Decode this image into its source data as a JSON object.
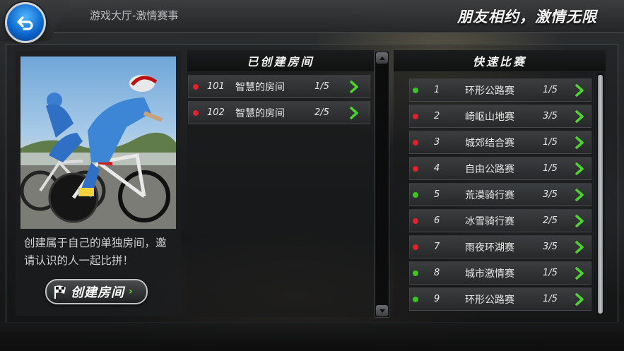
{
  "header": {
    "breadcrumb": "游戏大厅-激情赛事",
    "slogan": "朋友相约，激情无限",
    "back_icon": "back-arrow-icon"
  },
  "left_panel": {
    "description": "创建属于自己的单独房间，邀请认识的人一起比拼！",
    "create_button_label": "创建房间",
    "create_button_icon": "checkered-flag-icon"
  },
  "created_rooms": {
    "title": "已创建房间",
    "rooms": [
      {
        "id": "101",
        "name": "智慧的房间",
        "players": "1/5",
        "status": "red"
      },
      {
        "id": "102",
        "name": "智慧的房间",
        "players": "2/5",
        "status": "red"
      }
    ]
  },
  "quick_match": {
    "title": "快速比赛",
    "matches": [
      {
        "num": "1",
        "name": "环形公路赛",
        "players": "1/5",
        "status": "green"
      },
      {
        "num": "2",
        "name": "崎岖山地赛",
        "players": "3/5",
        "status": "red"
      },
      {
        "num": "3",
        "name": "城郊结合赛",
        "players": "1/5",
        "status": "red"
      },
      {
        "num": "4",
        "name": "自由公路赛",
        "players": "1/5",
        "status": "red"
      },
      {
        "num": "5",
        "name": "荒漠骑行赛",
        "players": "3/5",
        "status": "green"
      },
      {
        "num": "6",
        "name": "冰雪骑行赛",
        "players": "2/5",
        "status": "red"
      },
      {
        "num": "7",
        "name": "雨夜环湖赛",
        "players": "3/5",
        "status": "red"
      },
      {
        "num": "8",
        "name": "城市激情赛",
        "players": "1/5",
        "status": "green"
      },
      {
        "num": "9",
        "name": "环形公路赛",
        "players": "1/5",
        "status": "green"
      }
    ]
  },
  "colors": {
    "status_green": "#39c522",
    "status_red": "#e0222a",
    "arrow_green": "#49d52a"
  }
}
